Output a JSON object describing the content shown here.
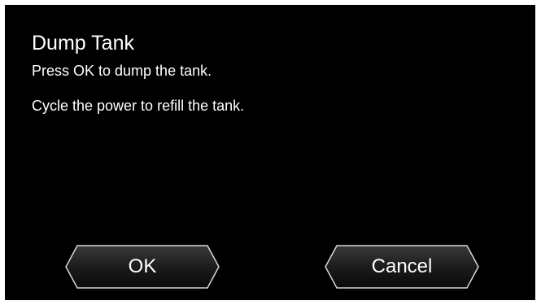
{
  "dialog": {
    "title": "Dump Tank",
    "line1": "Press OK to dump the tank.",
    "line2": "Cycle the power to refill the tank."
  },
  "buttons": {
    "ok_label": "OK",
    "cancel_label": "Cancel"
  },
  "colors": {
    "background": "#000000",
    "text": "#ffffff",
    "button_fill_top": "#3a3a3a",
    "button_fill_bottom": "#0a0a0a",
    "button_border": "#d8d8d8"
  }
}
